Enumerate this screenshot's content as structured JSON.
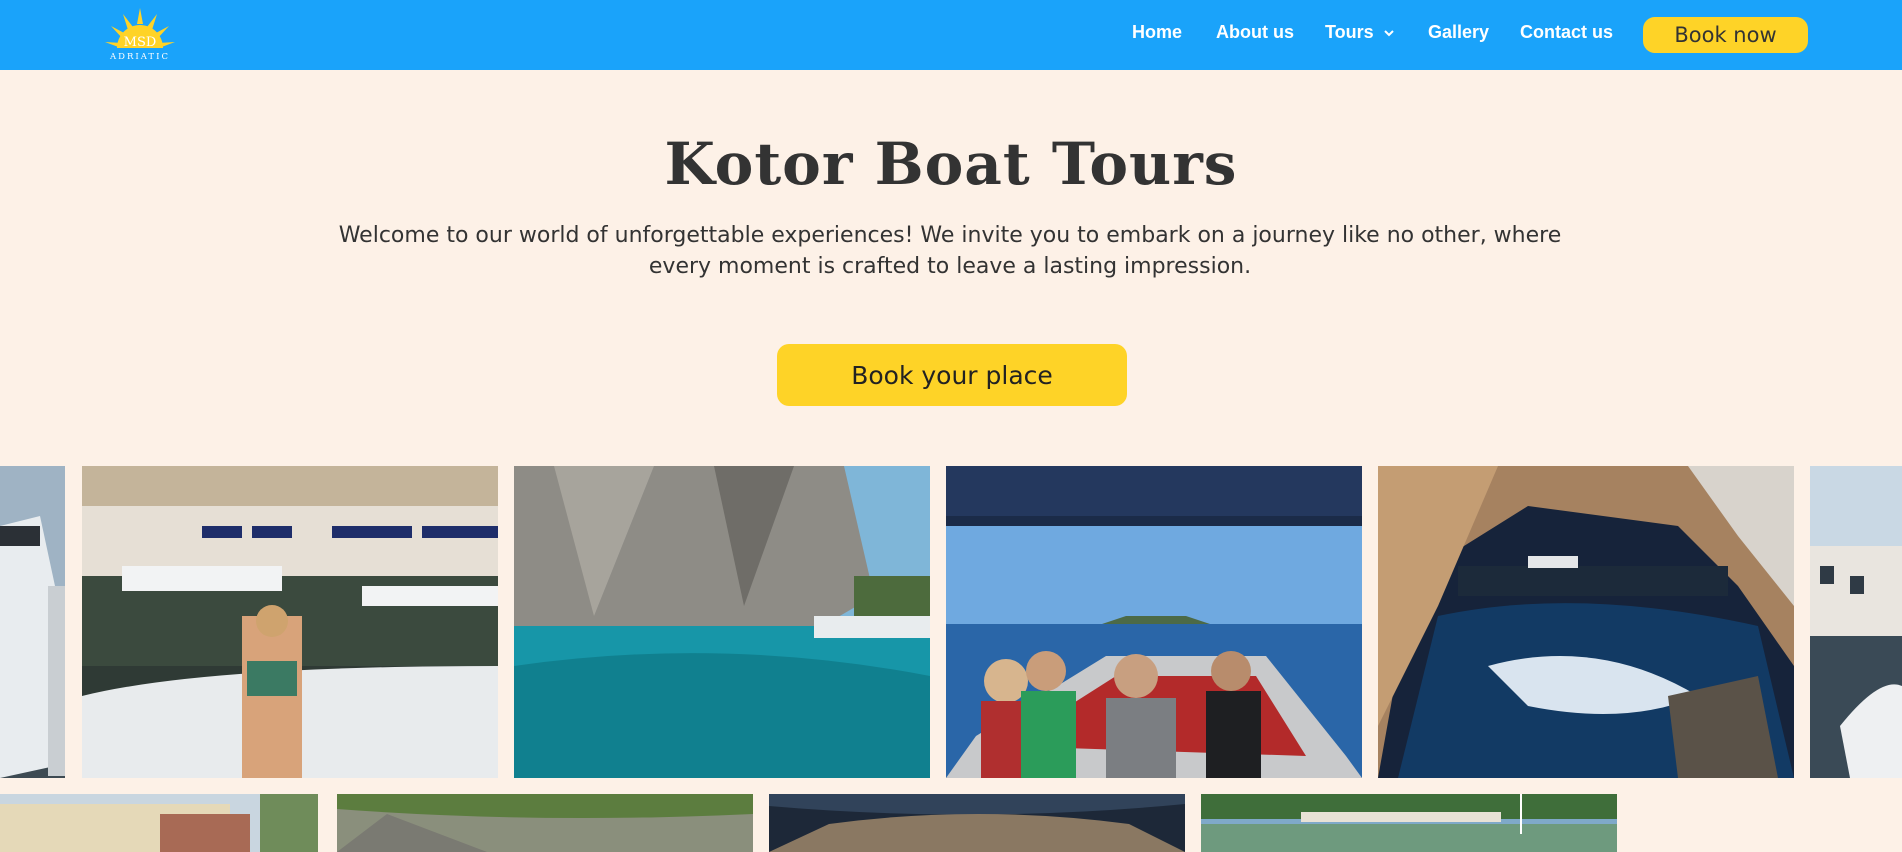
{
  "brand": {
    "logo_top": "MSD",
    "logo_bottom": "ADRIATIC"
  },
  "nav": {
    "home": "Home",
    "about": "About us",
    "tours": "Tours",
    "gallery": "Gallery",
    "contact": "Contact us",
    "book_now": "Book now"
  },
  "hero": {
    "title": "Kotor Boat Tours",
    "text": "Welcome to our world of unforgettable experiences! We invite you to embark on a journey like no other, where every moment is crafted to leave a lasting impression.",
    "cta": "Book your place"
  },
  "gallery": {
    "row1": [
      "boat-marina-photo",
      "woman-on-boat-photo",
      "cliff-turquoise-water-photo",
      "passengers-on-speedboat-photo",
      "sea-cave-photo",
      "harbor-edge-photo"
    ],
    "row2": [
      "villa-photo",
      "rocky-coast-photo",
      "cave-interior-photo",
      "lakeside-town-photo"
    ]
  },
  "colors": {
    "navbar": "#1aa3fa",
    "accent": "#fed327",
    "background": "#fdf1e7",
    "text": "#333333"
  }
}
